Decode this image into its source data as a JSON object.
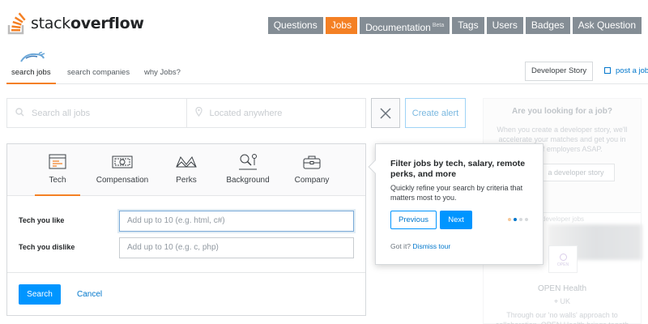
{
  "header": {
    "logo_plain": "stack",
    "logo_bold": "overflow",
    "nav": [
      {
        "label": "Questions",
        "active": false
      },
      {
        "label": "Jobs",
        "active": true
      },
      {
        "label": "Documentation",
        "badge": "Beta",
        "active": false
      },
      {
        "label": "Tags",
        "active": false
      },
      {
        "label": "Users",
        "active": false
      },
      {
        "label": "Badges",
        "active": false
      },
      {
        "label": "Ask Question",
        "active": false
      }
    ]
  },
  "subnav": {
    "tabs": [
      "search jobs",
      "search companies",
      "why Jobs?"
    ],
    "developer_story": "Developer Story",
    "post_job": "post a job"
  },
  "search": {
    "jobs_placeholder": "Search all jobs",
    "location_placeholder": "Located anywhere",
    "create_alert": "Create alert"
  },
  "filters": {
    "tabs": [
      "Tech",
      "Compensation",
      "Perks",
      "Background",
      "Company"
    ],
    "tech_like_label": "Tech you like",
    "tech_like_placeholder": "Add up to 10 (e.g. html, c#)",
    "tech_dislike_label": "Tech you dislike",
    "tech_dislike_placeholder": "Add up to 10 (e.g. c, php)",
    "search_button": "Search",
    "cancel_button": "Cancel"
  },
  "tour": {
    "title": "Filter jobs by tech, salary, remote perks, and more",
    "body": "Quickly refine your search by criteria that matters most to you.",
    "previous": "Previous",
    "next": "Next",
    "got_it": "Got it?",
    "dismiss": "Dismiss tour",
    "dot_count": 4,
    "active_dot": 1
  },
  "sidebar": {
    "title": "Are you looking for a job?",
    "text": "When you create a developer story, we'll accelerate your matches and get you in front of employers ASAP.",
    "button": "a developer story",
    "card_label": "developer jobs",
    "company": "OPEN Health",
    "location": "UK",
    "description": "Through our 'no walls' approach to collaboration, OPEN Health brings togeth"
  },
  "colors": {
    "accent": "#f48024",
    "nav_gray": "#848d95",
    "blue": "#0095ff",
    "link": "#0077cc"
  }
}
